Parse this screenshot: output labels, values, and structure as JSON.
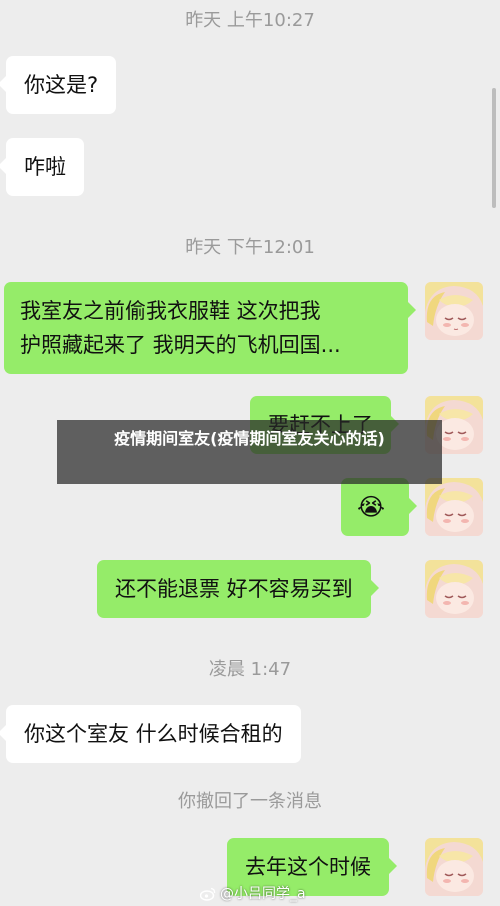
{
  "timestamps": {
    "t1": "昨天 上午10:27",
    "t2": "昨天 下午12:01",
    "t3": "凌晨 1:47"
  },
  "messages": {
    "m1": "你这是?",
    "m2": "咋啦",
    "m3_line1": "我室友之前偷我衣服鞋 这次把我",
    "m3_line2": "护照藏起来了 我明天的飞机回国...",
    "m4": "要赶不上了",
    "m5": "😭",
    "m6": "还不能退票 好不容易买到",
    "m7": "你这个室友 什么时候合租的",
    "m8": "去年这个时候"
  },
  "system_notice": "你撤回了一条消息",
  "overlay": {
    "title": "疫情期间室友(疫情期间室友关心的话)"
  },
  "watermark": {
    "text": "@小吕同学_a",
    "icon": "weibo-icon"
  },
  "colors": {
    "background": "#ededed",
    "incoming_bubble": "#ffffff",
    "outgoing_bubble": "#95ec69",
    "timestamp_text": "#9a9a9a"
  }
}
